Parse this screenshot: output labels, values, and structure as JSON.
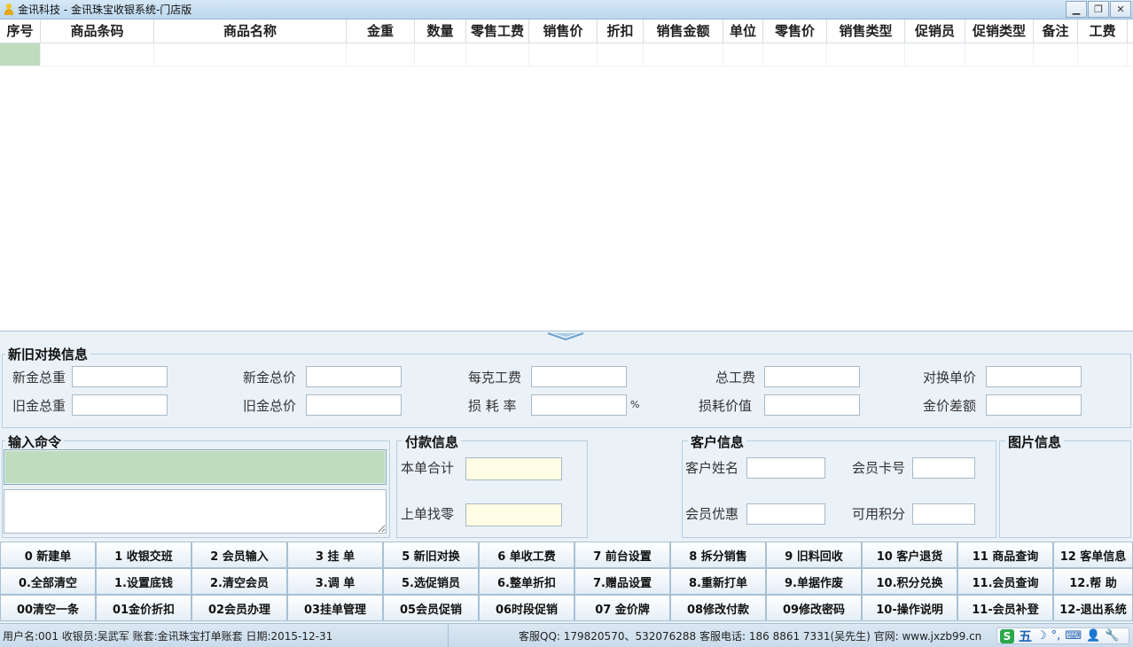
{
  "window": {
    "title": "金讯科技 - 金讯珠宝收银系统-门店版",
    "minimize": "▁",
    "maximize": "❐",
    "close": "✕"
  },
  "grid": {
    "columns": [
      "序号",
      "商品条码",
      "商品名称",
      "金重",
      "数量",
      "零售工费",
      "销售价",
      "折扣",
      "销售金额",
      "单位",
      "零售价",
      "销售类型",
      "促销员",
      "促销类型",
      "备注",
      "工费"
    ]
  },
  "exchange": {
    "title": "新旧对换信息",
    "new_weight": "新金总重",
    "new_price": "新金总价",
    "per_gram_fee": "每克工费",
    "total_fee": "总工费",
    "unit_price": "对换单价",
    "old_weight": "旧金总重",
    "old_price": "旧金总价",
    "loss_rate": "损 耗 率",
    "percent": "%",
    "loss_value": "损耗价值",
    "price_diff": "金价差额"
  },
  "command": {
    "title": "输入命令"
  },
  "payment": {
    "title": "付款信息",
    "total": "本单合计",
    "last_change": "上单找零"
  },
  "customer": {
    "title": "客户信息",
    "name": "客户姓名",
    "card": "会员卡号",
    "discount": "会员优惠",
    "points": "可用积分"
  },
  "image_info": {
    "title": "图片信息"
  },
  "fkeys": {
    "row1": [
      "0  新建单",
      "1  收银交班",
      "2  会员输入",
      "3  挂    单",
      "5  新旧对换",
      "6  单收工费",
      "7  前台设置",
      "8  拆分销售",
      "9  旧料回收",
      "10  客户退货",
      "11  商品查询",
      "12  客单信息"
    ],
    "row2": [
      "0.全部清空",
      "1.设置底钱",
      "2.清空会员",
      "3.调    单",
      "5.选促销员",
      "6.整单折扣",
      "7.赠品设置",
      "8.重新打单",
      "9.单据作废",
      "10.积分兑换",
      "11.会员查询",
      "12.帮    助"
    ],
    "row3": [
      "00清空一条",
      "01金价折扣",
      "02会员办理",
      "03挂单管理",
      "05会员促销",
      "06时段促销",
      "07  金价牌",
      "08修改付款",
      "09修改密码",
      "10-操作说明",
      "11-会员补登",
      "12-退出系统"
    ]
  },
  "status": {
    "left": "用户名:001  收银员:吴武军  账套:金讯珠宝打单账套  日期:2015-12-31",
    "right": "客服QQ: 179820570、532076288  客服电话: 186 8861 7331(吴先生)  官网: www.jxzb99.cn",
    "ime_wu": "五",
    "ime_s": "S"
  }
}
